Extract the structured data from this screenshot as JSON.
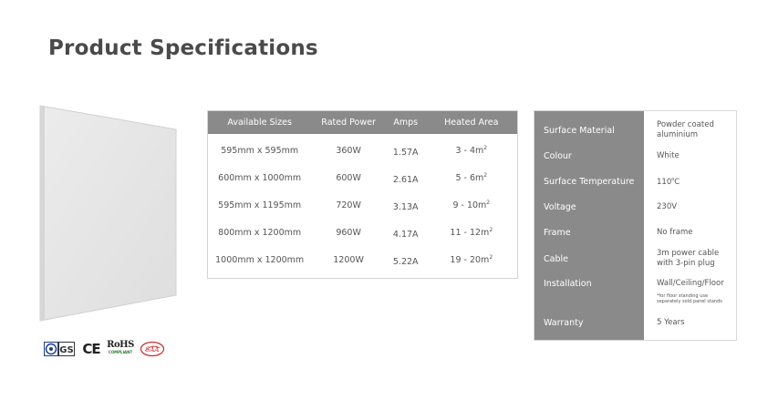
{
  "page": {
    "title": "Product Specifications"
  },
  "certifications": [
    {
      "name": "gs-mark-icon"
    },
    {
      "name": "ce-mark",
      "text": "CE"
    },
    {
      "name": "rohs-mark",
      "text": "RoHS",
      "sub": "COMPLIANT"
    },
    {
      "name": "saa-mark-icon",
      "text": "SAA"
    }
  ],
  "sizes_table": {
    "headers": [
      "Available Sizes",
      "Rated Power",
      "Amps",
      "Heated Area"
    ],
    "rows": [
      {
        "size": "595mm x 595mm",
        "power": "360W",
        "amps": "1.57A",
        "area": "3 - 4m",
        "unit_sup": "2"
      },
      {
        "size": "600mm x 1000mm",
        "power": "600W",
        "amps": "2.61A",
        "area": "5 - 6m",
        "unit_sup": "2"
      },
      {
        "size": "595mm x 1195mm",
        "power": "720W",
        "amps": "3.13A",
        "area": "9 - 10m",
        "unit_sup": "2"
      },
      {
        "size": "800mm x 1200mm",
        "power": "960W",
        "amps": "4.17A",
        "area": "11 - 12m",
        "unit_sup": "2"
      },
      {
        "size": "1000mm x 1200mm",
        "power": "1200W",
        "amps": "5.22A",
        "area": "19 - 20m",
        "unit_sup": "2"
      }
    ]
  },
  "spec_table": {
    "surface_material": {
      "label": "Surface Material",
      "value_line1": "Powder coated",
      "value_line2": "aluminium"
    },
    "colour": {
      "label": "Colour",
      "value": "White"
    },
    "surface_temperature": {
      "label": "Surface Temperature",
      "value": "110",
      "sup": "o",
      "unit": "C"
    },
    "voltage": {
      "label": "Voltage",
      "value": "230V"
    },
    "frame": {
      "label": "Frame",
      "value": "No frame"
    },
    "cable": {
      "label": "Cable",
      "value_line1": "3m  power cable",
      "value_line2": "with 3-pin plug"
    },
    "installation": {
      "label": "Installation",
      "value": "Wall/Ceiling/Floor",
      "note_line1": "*for floor standing use",
      "note_line2": "separately sold panel stands"
    },
    "warranty": {
      "label": "Warranty",
      "value": "5 Years"
    }
  },
  "colors": {
    "header_grey": "#8a8a8a",
    "border": "#d4d4d4",
    "title": "#4a4a4a"
  }
}
